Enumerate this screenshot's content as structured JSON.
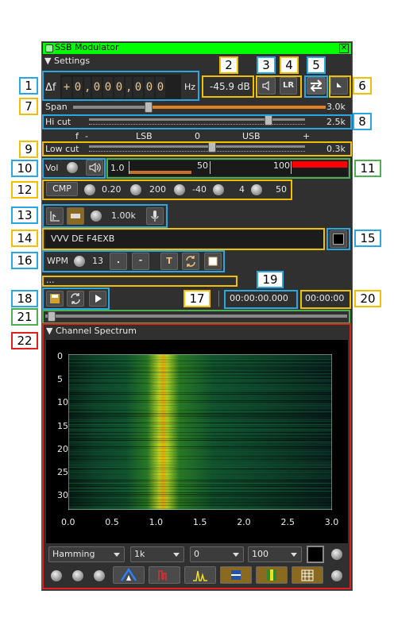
{
  "window": {
    "title": "SSB Modulator"
  },
  "settings": {
    "header": "Settings"
  },
  "delta_freq": {
    "label": "Δf",
    "sign": "+",
    "digits": [
      "0",
      ",",
      "0",
      "0",
      "0",
      ",",
      "0",
      "0",
      "0"
    ],
    "unit": "Hz"
  },
  "power": {
    "value": "-45.9 dB"
  },
  "icons": {
    "mute": "speaker-icon",
    "lr": "LR",
    "swap": "swap-arrows-icon",
    "corner": "corner-icon"
  },
  "span": {
    "label": "Span",
    "value": "3.0k",
    "fraction": 0.3
  },
  "hicut": {
    "label": "Hi cut",
    "value": "2.5k",
    "fraction": 0.83
  },
  "scale": {
    "f": "f",
    "minus": "-",
    "lsb": "LSB",
    "zero": "0",
    "usb": "USB",
    "plus": "+"
  },
  "lowcut": {
    "label": "Low cut",
    "value": "0.3k",
    "fraction": 0.57
  },
  "volume": {
    "label": "Vol",
    "scale_ticks": [
      "1.0",
      "50",
      "100"
    ],
    "level": 0.38
  },
  "compressor": {
    "label": "CMP",
    "values": [
      "0.20",
      "200",
      "-40",
      "4",
      "50"
    ]
  },
  "audio": {
    "value": "1.00k"
  },
  "text_input": {
    "value": "VVV DE F4EXB"
  },
  "morse": {
    "label": "WPM",
    "wpm": "13",
    "dot": ".",
    "dash": "-",
    "t_icon": "T"
  },
  "file": {
    "name": "...",
    "time_elapsed": "00:00:00.000",
    "time_total": "00:00:00"
  },
  "spectrum": {
    "header": "Channel Spectrum",
    "y_ticks": [
      "0",
      "5",
      "10",
      "15",
      "20",
      "25",
      "30"
    ],
    "x_ticks": [
      "0.0",
      "0.5",
      "1.0",
      "1.5",
      "2.0",
      "2.5",
      "3.0"
    ],
    "window": "Hamming",
    "fft_size": "1k",
    "ref": "0",
    "range": "100"
  },
  "annotations": {
    "n1": "1",
    "n2": "2",
    "n3": "3",
    "n4": "4",
    "n5": "5",
    "n6": "6",
    "n7": "7",
    "n8": "8",
    "n9": "9",
    "n10": "10",
    "n11": "11",
    "n12": "12",
    "n13": "13",
    "n14": "14",
    "n15": "15",
    "n16": "16",
    "n17": "17",
    "n18": "18",
    "n19": "19",
    "n20": "20",
    "n21": "21",
    "n22": "22"
  },
  "colors": {
    "title_green": "#00ff00",
    "annotation_blue": "#2aa7e0",
    "annotation_yellow": "#f0c000",
    "annotation_green": "#4caf50",
    "annotation_red": "#e02020"
  }
}
